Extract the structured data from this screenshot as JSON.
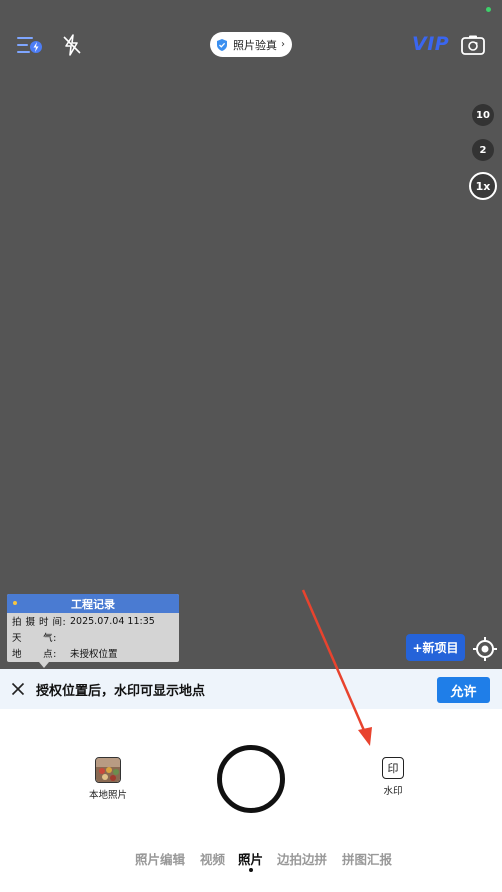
{
  "top_bar": {
    "verify_label": "照片验真",
    "vip_label": "VIP"
  },
  "zoom": [
    "10",
    "2",
    "1x"
  ],
  "watermark": {
    "title": "工程记录",
    "rows": [
      {
        "key": "拍 摄 时 间:",
        "value": "2025.07.04 11:35"
      },
      {
        "key": "天      气:",
        "value": ""
      },
      {
        "key": "地      点:",
        "value": "未授权位置"
      }
    ]
  },
  "new_project_label": "+新项目",
  "notice": {
    "text": "授权位置后，水印可显示地点",
    "allow_label": "允许"
  },
  "tools": {
    "local_photos_label": "本地照片",
    "watermark_label": "水印",
    "watermark_icon_char": "印"
  },
  "modes": [
    {
      "label": "照片编辑",
      "active": false
    },
    {
      "label": "视频",
      "active": false
    },
    {
      "label": "照片",
      "active": true
    },
    {
      "label": "边拍边拼",
      "active": false
    },
    {
      "label": "拼图汇报",
      "active": false
    }
  ],
  "colors": {
    "accent_blue": "#2563d9",
    "vip_blue": "#3a66f0",
    "arrow_red": "#e8432e",
    "viewfinder_gray": "#555555"
  }
}
